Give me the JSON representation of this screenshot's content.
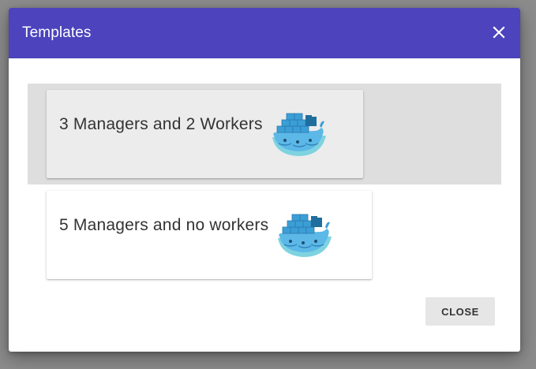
{
  "colors": {
    "header_bg": "#4c43bd",
    "header_text": "#ffffff",
    "selected_row_bg": "#dedede",
    "button_bg": "#e6e6e6",
    "whale_blue": "#3b9fd6",
    "whale_teal": "#7fd3e0"
  },
  "dialog": {
    "title": "Templates",
    "close_icon": "close-icon"
  },
  "templates": [
    {
      "label": "3 Managers and 2 Workers",
      "icon": "docker-whale-icon",
      "selected": true
    },
    {
      "label": "5 Managers and no workers",
      "icon": "docker-whale-icon",
      "selected": false
    }
  ],
  "actions": {
    "close_label": "CLOSE"
  }
}
